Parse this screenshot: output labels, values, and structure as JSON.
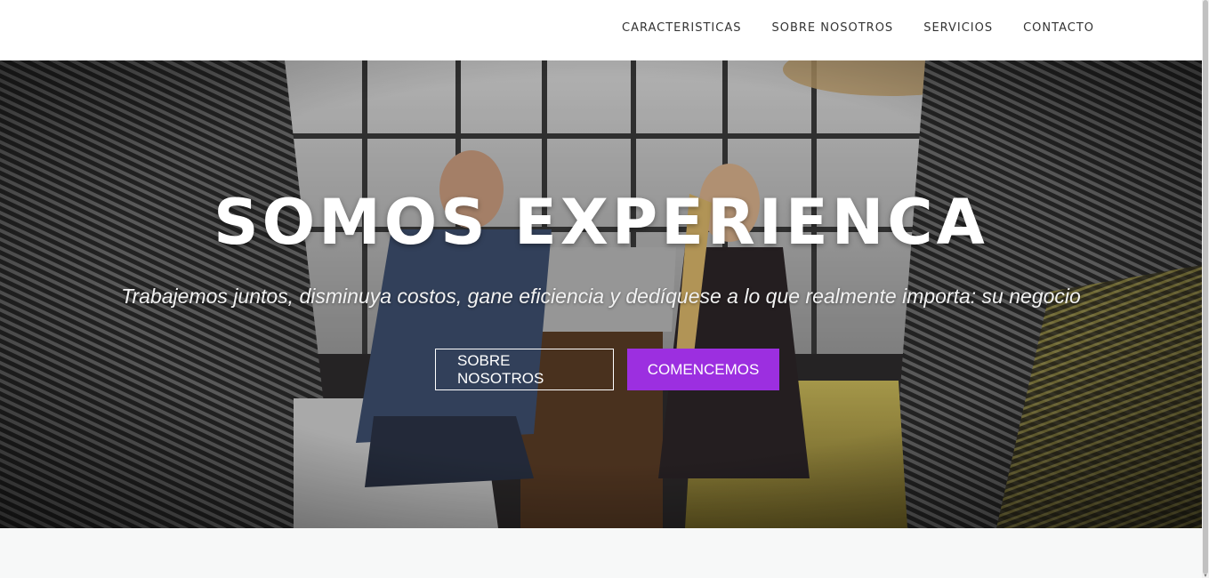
{
  "nav": {
    "items": [
      {
        "label": "CARACTERISTICAS"
      },
      {
        "label": "SOBRE NOSOTROS"
      },
      {
        "label": "SERVICIOS"
      },
      {
        "label": "CONTACTO"
      }
    ]
  },
  "hero": {
    "title": "SOMOS EXPERIENCA",
    "subtitle": "Trabajemos juntos, disminuya costos, gane eficiencia y dedíquese a lo que realmente importa: su negocio",
    "buttons": {
      "secondary_label": "SOBRE NOSOTROS",
      "primary_label": "COMENCEMOS"
    }
  },
  "colors": {
    "accent": "#9c2fe0",
    "nav_text": "#333333",
    "section_bg": "#f7f8f8"
  }
}
